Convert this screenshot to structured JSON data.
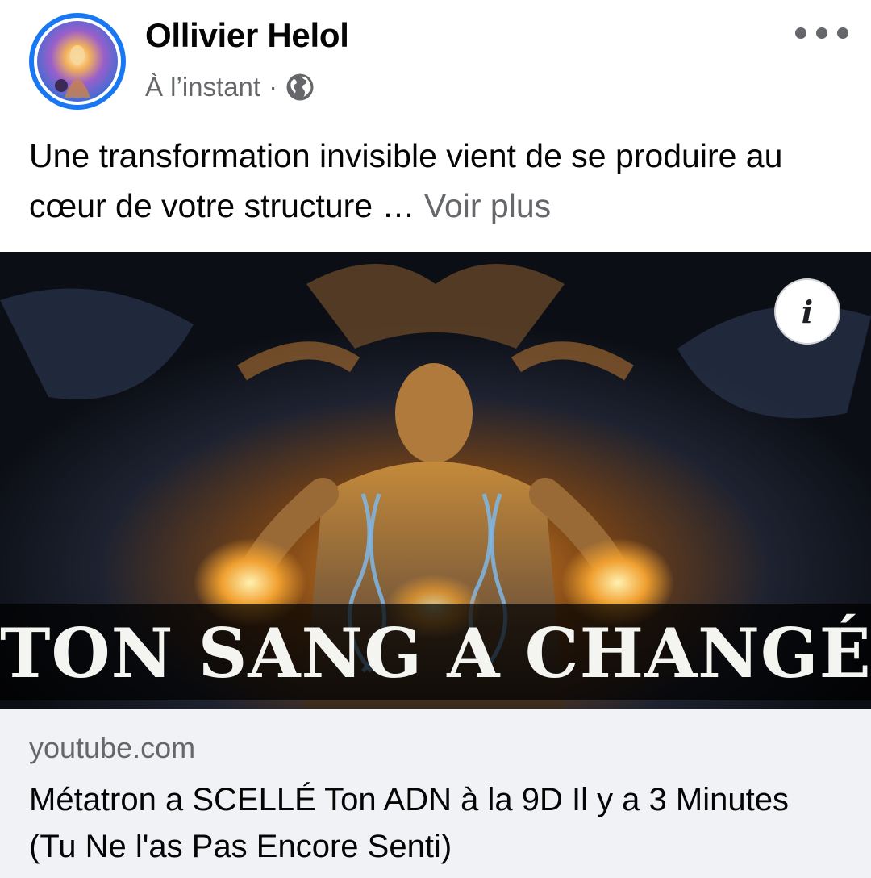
{
  "post": {
    "author": "Ollivier Helol",
    "time": "À l’instant",
    "separator": "·",
    "privacy_icon": "globe-icon",
    "more_icon": "more-options-icon",
    "text": "Une transformation invisible vient de se produire au cœur de votre structure …",
    "see_more": "Voir plus"
  },
  "media": {
    "overlay_text": "TON SANG A CHANGÉ",
    "info_label": "i"
  },
  "link": {
    "domain": "youtube.com",
    "title": "Métatron a SCELLÉ Ton ADN à la 9D Il y a 3 Minutes (Tu Ne l'as Pas Encore Senti)"
  },
  "colors": {
    "accent": "#1877f2",
    "secondary_text": "#65676b",
    "card_bg": "#f0f2f5"
  }
}
